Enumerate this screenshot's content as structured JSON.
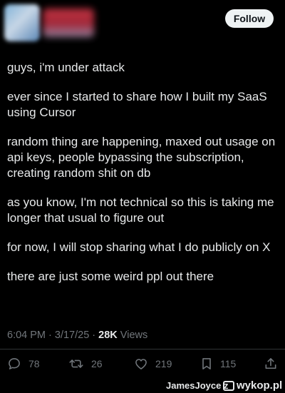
{
  "header": {
    "follow_label": "Follow"
  },
  "tweet": {
    "paragraphs": [
      "guys, i'm under attack",
      "ever since I started to share how I built my SaaS using Cursor",
      "random thing are happening, maxed out usage on api keys, people bypassing the subscription, creating random shit on db",
      "as you know, I'm not technical so this is taking me longer that usual to figure out",
      "for now, I will stop sharing what I do publicly on X",
      "there are just some weird ppl out there"
    ]
  },
  "meta": {
    "time": "6:04 PM",
    "separator": " · ",
    "date": "3/17/25",
    "views_count": "28K",
    "views_label": " Views"
  },
  "actions": {
    "reply_count": "78",
    "retweet_count": "26",
    "like_count": "219",
    "bookmark_count": "115",
    "icons": [
      "reply-icon",
      "retweet-icon",
      "like-icon",
      "bookmark-icon",
      "share-icon"
    ]
  },
  "footer": {
    "author_text": "JamesJoyce z",
    "site_label": "wykop.pl"
  },
  "colors": {
    "background": "#000000",
    "text": "#e7e9ea",
    "muted": "#71767b",
    "follow_bg": "#eff3f4"
  }
}
